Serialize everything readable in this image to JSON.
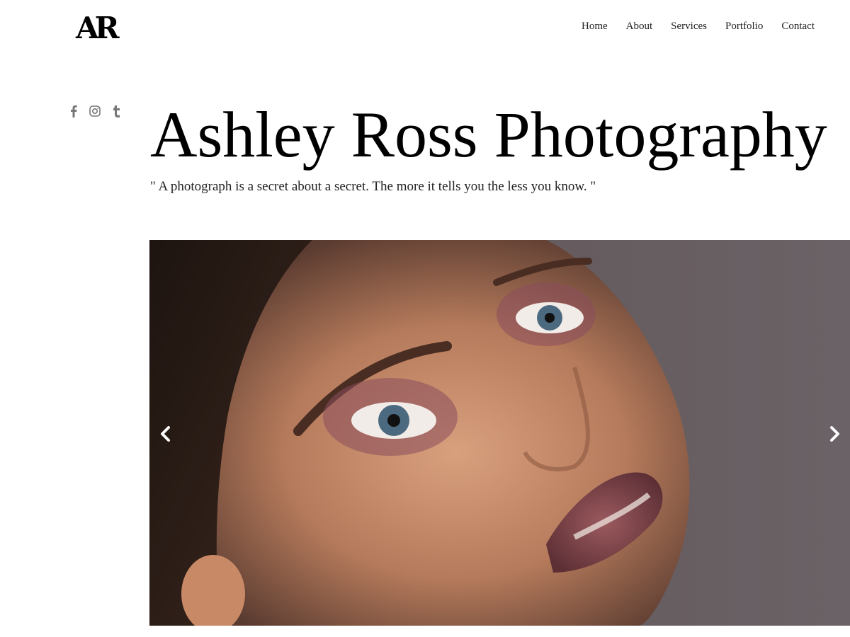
{
  "header": {
    "logo_text": "AR",
    "nav": [
      {
        "label": "Home"
      },
      {
        "label": "About"
      },
      {
        "label": "Services"
      },
      {
        "label": "Portfolio"
      },
      {
        "label": "Contact"
      }
    ]
  },
  "social": {
    "icons": [
      "facebook-icon",
      "instagram-icon",
      "tumblr-icon"
    ],
    "color": "#777777"
  },
  "hero": {
    "title": "Ashley Ross Photography",
    "quote": "\" A photograph is a secret about a secret. The more it tells you the less you know. \""
  },
  "slider": {
    "image_description_icon": "portrait-photo",
    "prev_icon": "chevron-left-icon",
    "next_icon": "chevron-right-icon"
  },
  "colors": {
    "text": "#111111",
    "background": "#ffffff",
    "arrow": "#ffffff"
  }
}
